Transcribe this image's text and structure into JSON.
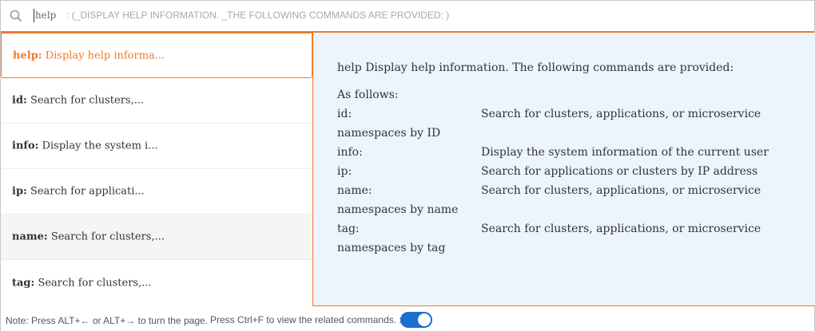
{
  "search": {
    "query": "help",
    "hint": ": (_DISPLAY HELP INFORMATION. _THE FOLLOWING COMMANDS ARE PROVIDED: )"
  },
  "commands": [
    {
      "name": "help:",
      "summary": " Display help informa..."
    },
    {
      "name": "id:",
      "summary": " Search for clusters,..."
    },
    {
      "name": "info:",
      "summary": " Display the system i..."
    },
    {
      "name": "ip:",
      "summary": " Search for applicati..."
    },
    {
      "name": "name:",
      "summary": " Search for clusters,..."
    },
    {
      "name": "tag:",
      "summary": " Search for clusters,..."
    }
  ],
  "detail": {
    "intro": "help Display help information. The following commands are provided:",
    "as_follows": "As follows:",
    "rows": [
      {
        "cmd": "id:",
        "desc": "Search for clusters, applications, or microservice",
        "cont": "namespaces by ID"
      },
      {
        "cmd": "info:",
        "desc": "Display the system information of the current user"
      },
      {
        "cmd": "ip:",
        "desc": "Search for applications or clusters by IP address"
      },
      {
        "cmd": "name:",
        "desc": "Search for clusters, applications, or microservice",
        "cont": "namespaces by name"
      },
      {
        "cmd": "tag:",
        "desc": "Search for clusters, applications, or microservice",
        "cont": "namespaces by tag"
      }
    ]
  },
  "footer": {
    "note": "Note: Press ALT+← or ALT+→ to turn the page.",
    "ctrl": "Press Ctrl+F to view the related commands. :"
  },
  "toggle": {
    "on": true
  },
  "colors": {
    "accent": "#f07a2c",
    "toggle": "#1a6fd1",
    "panel": "#ecf4fd"
  },
  "icons": {
    "search": "search-icon"
  }
}
